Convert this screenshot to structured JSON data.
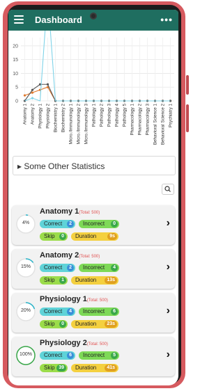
{
  "header": {
    "title": "Dashboard",
    "menu_icon": "hamburger-icon",
    "more_icon": "more-dots-icon"
  },
  "chart_data": {
    "type": "line",
    "categories": [
      "Anatomy 1",
      "Anatomy 2",
      "Physiology 1",
      "Physiology 2",
      "Biochemistry 1",
      "Biochemistry 2",
      "Micro./Immunology 1",
      "Micro./Immunology 2",
      "Micro./Immunology 3",
      "Pathology 1",
      "Pathology 2",
      "Pathology 3",
      "Pathology 4",
      "Pathology 5",
      "Pharmacology 1",
      "Pharmacology 2",
      "Pharmacology 3",
      "Behavioral Science 1",
      "Behavioral Science 2",
      "Psychiatry 1"
    ],
    "series": [
      {
        "color": "#e07a2e",
        "values": [
          2,
          3,
          4,
          5,
          0,
          0,
          0,
          0,
          0,
          0,
          0,
          0,
          0,
          0,
          0,
          0,
          0,
          0,
          0,
          0
        ]
      },
      {
        "color": "#555555",
        "values": [
          0,
          4,
          6,
          6,
          0,
          0,
          0,
          0,
          0,
          0,
          0,
          0,
          0,
          0,
          0,
          0,
          0,
          0,
          0,
          0
        ]
      },
      {
        "color": "#7fd3e8",
        "values": [
          0,
          1,
          0,
          39,
          0,
          0,
          0,
          0,
          0,
          0,
          0,
          0,
          0,
          0,
          0,
          0,
          0,
          0,
          0,
          0
        ]
      }
    ],
    "yticks": [
      "0",
      "5",
      "10",
      "15",
      "20"
    ],
    "ylim": [
      0,
      23
    ],
    "grid": true
  },
  "statistics": {
    "label": "Some Other Statistics",
    "expander_icon": "triangle-right-icon"
  },
  "search": {
    "icon": "search-icon"
  },
  "cards": [
    {
      "title": "Anatomy 1",
      "total": "(Total: 500)",
      "percent": "4%",
      "progress": 0.04,
      "correct_label": "Correct",
      "correct": "2",
      "incorrect_label": "Incorrect",
      "incorrect": "0",
      "skip_label": "Skip",
      "skip": "0",
      "duration_label": "Duration",
      "duration": "9s"
    },
    {
      "title": "Anatomy 2",
      "total": "(Total: 500)",
      "percent": "15%",
      "progress": 0.15,
      "correct_label": "Correct",
      "correct": "2",
      "incorrect_label": "Incorrect",
      "incorrect": "4",
      "skip_label": "Skip",
      "skip": "1",
      "duration_label": "Duration",
      "duration": "13s"
    },
    {
      "title": "Physiology 1",
      "total": "(Total: 500)",
      "percent": "20%",
      "progress": 0.2,
      "correct_label": "Correct",
      "correct": "4",
      "incorrect_label": "Incorrect",
      "incorrect": "6",
      "skip_label": "Skip",
      "skip": "0",
      "duration_label": "Duration",
      "duration": "23s"
    },
    {
      "title": "Physiology 2",
      "total": "(Total: 500)",
      "percent": "100%",
      "progress": 1.0,
      "correct_label": "Correct",
      "correct": "6",
      "incorrect_label": "Incorrect",
      "incorrect": "5",
      "skip_label": "Skip",
      "skip": "39",
      "duration_label": "Duration",
      "duration": "41s"
    }
  ],
  "colors": {
    "appbar": "#1f6e60",
    "correct": "#5fd3d8",
    "incorrect": "#7ed957",
    "skip": "#9bdc4a",
    "duration": "#f4d03f",
    "correct_badge": "#3a8fd8",
    "incorrect_badge": "#3aa84a",
    "skip_badge": "#3aa84a",
    "duration_badge": "#e0a020",
    "ring": "#2bb3c8",
    "ring_full": "#3aa84a"
  }
}
